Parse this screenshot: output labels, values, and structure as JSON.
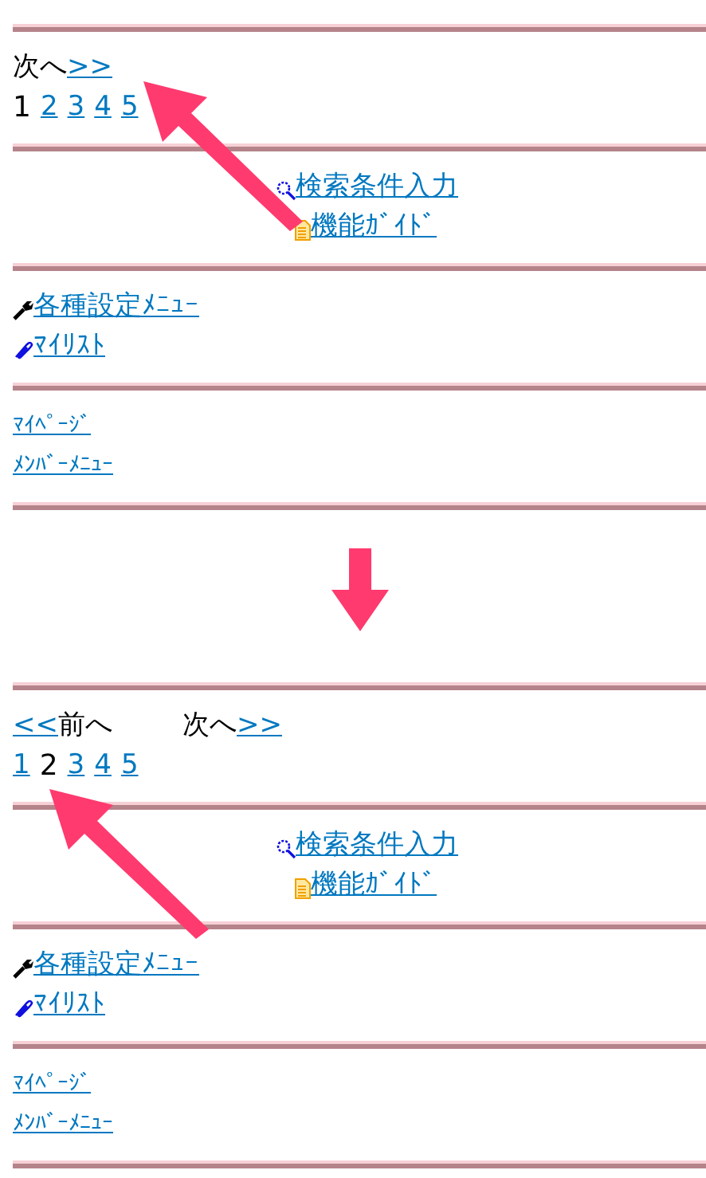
{
  "panels": [
    {
      "pager": {
        "next_label": "次へ",
        "next_link": ">>"
      },
      "pages": [
        {
          "label": "1",
          "selected": true
        },
        {
          "label": "2",
          "selected": false
        },
        {
          "label": "3",
          "selected": false
        },
        {
          "label": "4",
          "selected": false
        },
        {
          "label": "5",
          "selected": false
        }
      ],
      "center_links": [
        {
          "label": "検索条件入力"
        },
        {
          "label": "機能ｶﾞｲﾄﾞ"
        }
      ],
      "menu_links": [
        {
          "label": "各種設定ﾒﾆｭｰ"
        },
        {
          "label": "ﾏｲﾘｽﾄ"
        }
      ],
      "footer_links": [
        {
          "label": "ﾏｲﾍﾟｰｼﾞ"
        },
        {
          "label": "ﾒﾝﾊﾞｰﾒﾆｭｰ"
        }
      ]
    },
    {
      "pager": {
        "prev_link": "<<",
        "prev_label": "前へ",
        "next_label": "次へ",
        "next_link": ">>"
      },
      "pages": [
        {
          "label": "1",
          "selected": false
        },
        {
          "label": "2",
          "selected": true
        },
        {
          "label": "3",
          "selected": false
        },
        {
          "label": "4",
          "selected": false
        },
        {
          "label": "5",
          "selected": false
        }
      ],
      "center_links": [
        {
          "label": "検索条件入力"
        },
        {
          "label": "機能ｶﾞｲﾄﾞ"
        }
      ],
      "menu_links": [
        {
          "label": "各種設定ﾒﾆｭｰ"
        },
        {
          "label": "ﾏｲﾘｽﾄ"
        }
      ],
      "footer_links": [
        {
          "label": "ﾏｲﾍﾟｰｼﾞ"
        },
        {
          "label": "ﾒﾝﾊﾞｰﾒﾆｭｰ"
        }
      ]
    }
  ]
}
